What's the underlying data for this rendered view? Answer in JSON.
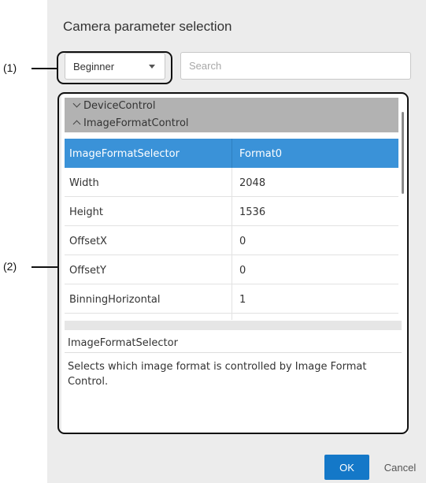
{
  "dialog": {
    "title": "Camera parameter selection",
    "level_select": {
      "value": "Beginner"
    },
    "search": {
      "placeholder": "Search"
    },
    "groups": [
      {
        "label": "DeviceControl",
        "expanded": false
      },
      {
        "label": "ImageFormatControl",
        "expanded": true
      }
    ],
    "rows": [
      {
        "name": "ImageFormatSelector",
        "value": "Format0"
      },
      {
        "name": "Width",
        "value": "2048"
      },
      {
        "name": "Height",
        "value": "1536"
      },
      {
        "name": "OffsetX",
        "value": "0"
      },
      {
        "name": "OffsetY",
        "value": "0"
      },
      {
        "name": "BinningHorizontal",
        "value": "1"
      }
    ],
    "selected_row": "ImageFormatSelector",
    "description": {
      "title": "ImageFormatSelector",
      "text_line1": "Selects which image format is controlled by Image Format",
      "text_line2": "Control."
    },
    "buttons": {
      "ok": "OK",
      "cancel": "Cancel"
    }
  },
  "callouts": {
    "c1": "(1)",
    "c2": "(2)"
  },
  "colors": {
    "accent": "#1478c8",
    "selected_row": "#3a92d8",
    "group_header": "#b2b2b2"
  },
  "icons": {
    "group_collapsed": "chevron-down-icon",
    "group_expanded": "chevron-up-icon",
    "dropdown": "caret-down-icon"
  }
}
